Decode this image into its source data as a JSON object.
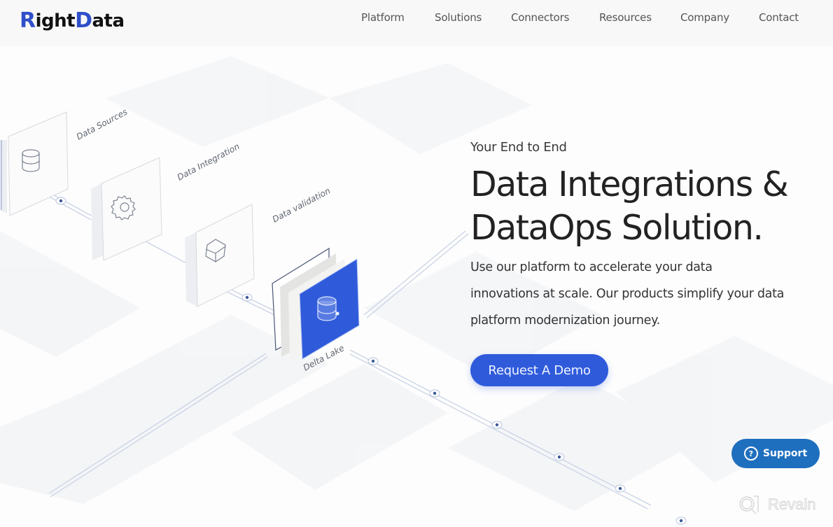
{
  "brand": {
    "logo_prefix": "R",
    "logo_mid": "ight",
    "logo_d": "D",
    "logo_suffix": "ata",
    "primary_color": "#2f5bdb",
    "logo_color": "#2f4fc9"
  },
  "nav": {
    "items": [
      {
        "label": "Platform"
      },
      {
        "label": "Solutions"
      },
      {
        "label": "Connectors"
      },
      {
        "label": "Resources"
      },
      {
        "label": "Company"
      },
      {
        "label": "Contact"
      }
    ]
  },
  "illustration": {
    "labels": [
      "Data Sources",
      "Data Integration",
      "Data validation",
      "Delta Lake"
    ],
    "icons": [
      "database-icon",
      "gear-icon",
      "cube-icon",
      "database-icon"
    ]
  },
  "hero": {
    "eyebrow": "Your End to End",
    "headline_line1": "Data Integrations &",
    "headline_line2": "DataOps Solution.",
    "description_line1": "Use our platform to accelerate your data",
    "description_line2": "innovations at scale. Our products simplify your data",
    "description_line3": "platform modernization journey.",
    "cta_label": "Request A Demo"
  },
  "support": {
    "label": "Support",
    "icon_glyph": "?",
    "color": "#1f6fbf"
  },
  "watermark": {
    "label": "Revain"
  }
}
